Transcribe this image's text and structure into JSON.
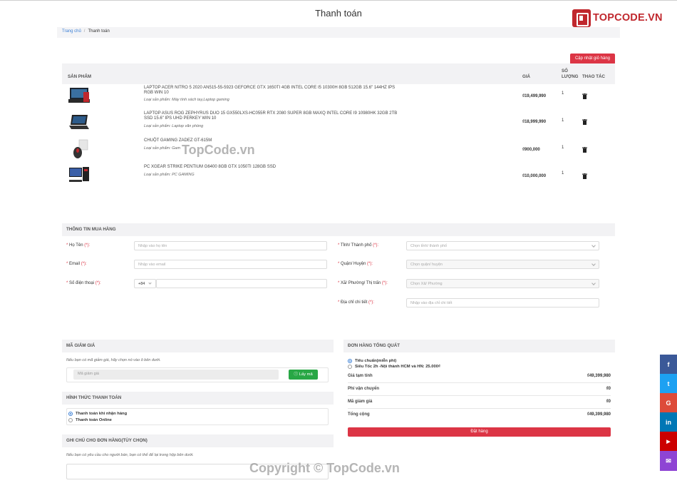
{
  "page": {
    "title": "Thanh toán"
  },
  "logo": {
    "text": "TOPCODE.VN"
  },
  "breadcrumb": {
    "home": "Trang chủ",
    "current": "Thanh toán"
  },
  "cart": {
    "update_label": "Cập nhật giỏ hàng",
    "headers": {
      "product": "SẢN PHẨM",
      "price": "GIÁ",
      "qty": "SỐ LƯỢNG",
      "action": "THAO TÁC"
    },
    "items": [
      {
        "name": "LAPTOP ACER NITRO 5 2020 AN515-55-5923 GEFORCE GTX 1650TI 4GB INTEL CORE I5 10300H 8GB 512GB 15.6\" 144HZ IPS RGB WIN 10",
        "category": "Loại sản phẩm: Máy tính xách tay,Laptop gaming",
        "price": "₫19,499,990",
        "qty": "1"
      },
      {
        "name": "LAPTOP ASUS ROG ZEPHYRUS DUO 15 GX550LXS-HC055R RTX 2080 SUPER 8GB MAXQ INTEL CORE I9 10980HK 32GB 2TB SSD 15.6\" IPS UHD PERKEY WIN 10",
        "category": "Loại sản phẩm: Laptop văn phòng",
        "price": "₫18,999,990",
        "qty": "1"
      },
      {
        "name": "CHUỘT GAMING ZADEZ GT-615M",
        "category": "Loại sản phẩm: Gam",
        "price": "₫900,000",
        "qty": "1"
      },
      {
        "name": "PC XGEAR STRIKE PENTIUM G6400 8GB GTX 1050TI 128GB SSD",
        "category": "Loại sản phẩm: PC GAMING",
        "price": "₫10,000,000",
        "qty": "1"
      }
    ]
  },
  "buyer": {
    "header": "THÔNG TIN MUA HÀNG",
    "name_label": "Họ Tên",
    "name_placeholder": "Nhập vào họ tên",
    "email_label": "Email",
    "email_placeholder": "Nhập vào email",
    "phone_label": "Số điện thoại",
    "phone_prefix": "+84",
    "province_label": "Tỉnh/ Thành phố",
    "province_placeholder": "Chọn tỉnh/ thành phố",
    "district_label": "Quận/ Huyện",
    "district_placeholder": "Chọn quận/ huyện",
    "ward_label": "Xã/ Phường/ Thị trấn",
    "ward_placeholder": "Chọn Xã/ Phường",
    "address_label": "Địa chỉ chi tiết",
    "address_placeholder": "Nhập vào địa chỉ chi tiết",
    "required_mark": "(*):"
  },
  "coupon": {
    "header": "MÃ GIẢM GIÁ",
    "note": "Nếu bạn có mã giảm giá, hãy chọn nó vào ô bên dưới.",
    "placeholder": "Mã giảm giá",
    "button": "Lấy mã"
  },
  "payment": {
    "header": "HÌNH THỨC THANH TOÁN",
    "options": [
      "Thanh toán khi nhận hàng",
      "Thanh toán Online"
    ]
  },
  "order_note": {
    "header": "GHI CHÚ CHO ĐƠN HÀNG(TÙY CHỌN)",
    "note": "Nếu bạn có yêu cầu cho người bán, bạn có thể để lại trong hộp bên dưới."
  },
  "summary": {
    "header": "ĐƠN HÀNG TỔNG QUÁT",
    "shipping_options": [
      "Tiêu chuẩn(miễn phí)",
      "Siêu Tốc 2h -Nội thành HCM và HN: 25.000₫"
    ],
    "rows": [
      {
        "label": "Giá tạm tính",
        "value": "₫49,399,980"
      },
      {
        "label": "Phí vận chuyển",
        "value": "₫0"
      },
      {
        "label": "Mã giảm giá",
        "value": "₫0"
      },
      {
        "label": "Tổng cộng",
        "value": "₫49,399,980"
      }
    ],
    "order_button": "Đặt hàng"
  },
  "social": [
    {
      "icon": "facebook-icon",
      "glyph": "f",
      "color": "#3b5998"
    },
    {
      "icon": "twitter-icon",
      "glyph": "t",
      "color": "#1da1f2"
    },
    {
      "icon": "google-icon",
      "glyph": "G",
      "color": "#dd4b39"
    },
    {
      "icon": "linkedin-icon",
      "glyph": "in",
      "color": "#0077b5"
    },
    {
      "icon": "youtube-icon",
      "glyph": "▶",
      "color": "#cc0000"
    },
    {
      "icon": "messenger-icon",
      "glyph": "✉",
      "color": "#8e44d4"
    }
  ],
  "watermarks": {
    "center": "TopCode.vn",
    "bottom": "Copyright © TopCode.vn"
  }
}
